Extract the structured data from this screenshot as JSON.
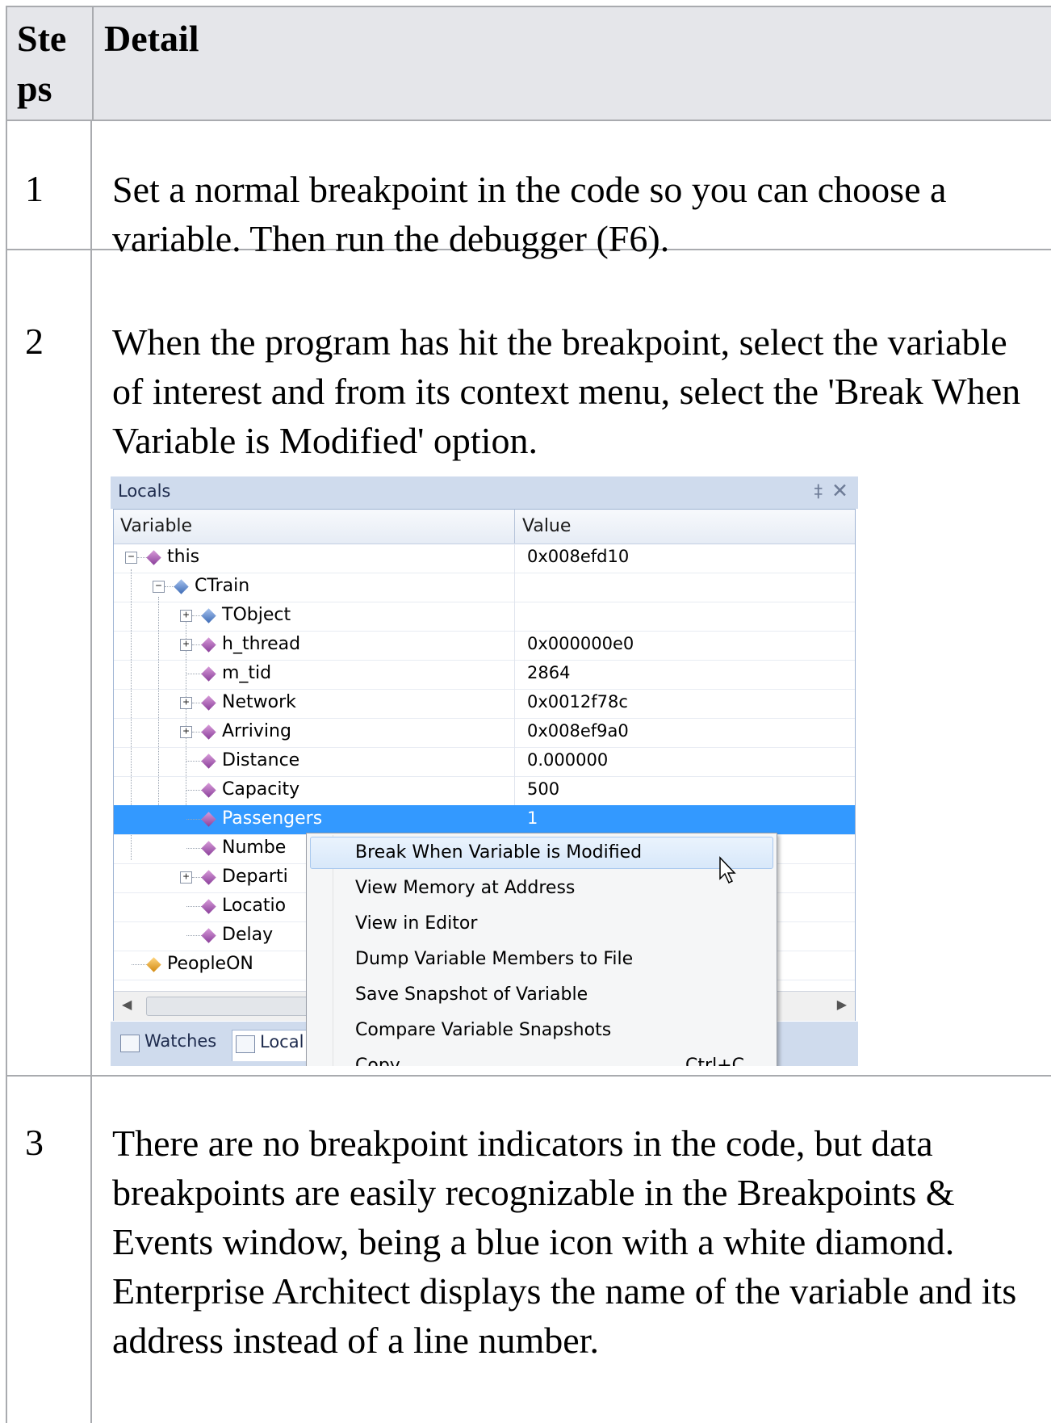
{
  "table": {
    "header": {
      "steps": "Ste ps",
      "detail": "Detail"
    },
    "rows": [
      {
        "num": "1",
        "text": "Set a normal breakpoint in the code so you can choose a variable. Then run the debugger (F6)."
      },
      {
        "num": "2",
        "text": "When the program has hit the breakpoint, select the variable of interest and from its context menu, select the 'Break When Variable is Modified' option."
      },
      {
        "num": "3",
        "text": "There are no breakpoint indicators in the code, but data breakpoints are easily recognizable in the Breakpoints & Events window, being a blue icon with a white diamond. Enterprise Architect displays the name of the variable and its address instead of a line number."
      }
    ]
  },
  "locals": {
    "title": "Locals",
    "pin_icon": "‡",
    "close_icon": "✕",
    "columns": {
      "variable": "Variable",
      "value": "Value"
    },
    "rows": [
      {
        "name": "this",
        "value": "0x008efd10"
      },
      {
        "name": "CTrain",
        "value": ""
      },
      {
        "name": "TObject",
        "value": ""
      },
      {
        "name": "h_thread",
        "value": "0x000000e0"
      },
      {
        "name": "m_tid",
        "value": "2864"
      },
      {
        "name": "Network",
        "value": "0x0012f78c"
      },
      {
        "name": "Arriving",
        "value": "0x008ef9a0"
      },
      {
        "name": "Distance",
        "value": "0.000000"
      },
      {
        "name": "Capacity",
        "value": "500"
      },
      {
        "name": "Passengers",
        "value": "1"
      },
      {
        "name": "Numbe",
        "value": ""
      },
      {
        "name": "Departi",
        "value": ""
      },
      {
        "name": "Locatio",
        "value": ""
      },
      {
        "name": "Delay",
        "value": ""
      },
      {
        "name": "PeopleON",
        "value": ""
      }
    ],
    "tabs": {
      "watches": "Watches",
      "locals": "Local"
    }
  },
  "context_menu": {
    "items": [
      "Break When Variable is Modified",
      "View Memory at Address",
      "View in Editor",
      "Dump Variable Members to File",
      "Save Snapshot of Variable",
      "Compare Variable Snapshots",
      "Copy"
    ],
    "copy_shortcut": "Ctrl+C"
  }
}
